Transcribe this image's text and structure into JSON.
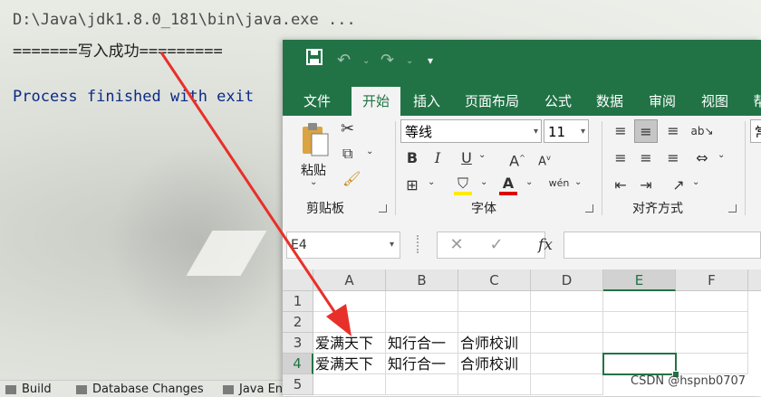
{
  "console": {
    "lines": [
      "D:\\Java\\jdk1.8.0_181\\bin\\java.exe ...",
      "=======写入成功=========",
      "Process finished with exit"
    ]
  },
  "statusbar": {
    "items": [
      "Build",
      "Database Changes",
      "Java En"
    ]
  },
  "excel": {
    "tabs": [
      "文件",
      "开始",
      "插入",
      "页面布局",
      "公式",
      "数据",
      "审阅",
      "视图",
      "帮"
    ],
    "ribbon": {
      "paste_label": "粘贴",
      "font_name": "等线",
      "font_size": "11",
      "group_clipboard": "剪贴板",
      "group_font": "字体",
      "group_alignment": "对齐方式",
      "number_format_partial": "常"
    },
    "namebox": "E4",
    "columns": [
      "A",
      "B",
      "C",
      "D",
      "E",
      "F"
    ],
    "rows": [
      "1",
      "2",
      "3",
      "4",
      "5"
    ],
    "cells": {
      "A3": "爱满天下",
      "B3": "知行合一",
      "C3": "合师校训",
      "A4": "爱满天下",
      "B4": "知行合一",
      "C4": "合师校训"
    },
    "selected_cell": "E4",
    "theme_color": "#217346"
  },
  "watermark": "CSDN @hspnb0707",
  "annotation_color": "#e8302a"
}
